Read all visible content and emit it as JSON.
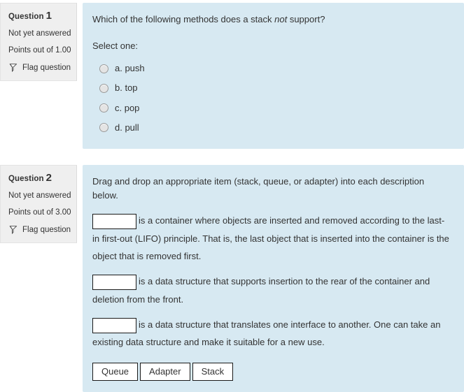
{
  "colors": {
    "content_bg": "#d7e9f2",
    "info_bg": "#efefef",
    "text": "#333333",
    "box_border": "#1a1a1a"
  },
  "questions": [
    {
      "info": {
        "label": "Question",
        "number": "1",
        "state": "Not yet answered",
        "grade": "Points out of 1.00",
        "flag_label": "Flag question",
        "flag_icon": "flag-icon"
      },
      "stem_before": "Which of the following methods does a stack ",
      "stem_emphasis": "not",
      "stem_after": " support?",
      "select_one": "Select one:",
      "answers": [
        {
          "label": "a. push",
          "selected": false
        },
        {
          "label": "b. top",
          "selected": false
        },
        {
          "label": "c. pop",
          "selected": false
        },
        {
          "label": "d. pull",
          "selected": false
        }
      ]
    },
    {
      "info": {
        "label": "Question",
        "number": "2",
        "state": "Not yet answered",
        "grade": "Points out of 3.00",
        "flag_label": "Flag question",
        "flag_icon": "flag-icon"
      },
      "intro": "Drag and drop an appropriate item (stack, queue, or adapter) into each description below.",
      "gaps": [
        {
          "placeholder": "",
          "text": "is a container where objects are inserted and removed according to the last-in first-out (LIFO) principle. That is, the last object that is inserted into the container is the object that is removed first."
        },
        {
          "placeholder": "",
          "text": "is a data structure that supports insertion to the rear of the container and deletion from the front."
        },
        {
          "placeholder": "",
          "text": "is a data structure that translates one interface to another.  One can take an existing data structure and make it suitable for a new use."
        }
      ],
      "drag_items": [
        "Queue",
        "Adapter",
        "Stack"
      ]
    }
  ]
}
